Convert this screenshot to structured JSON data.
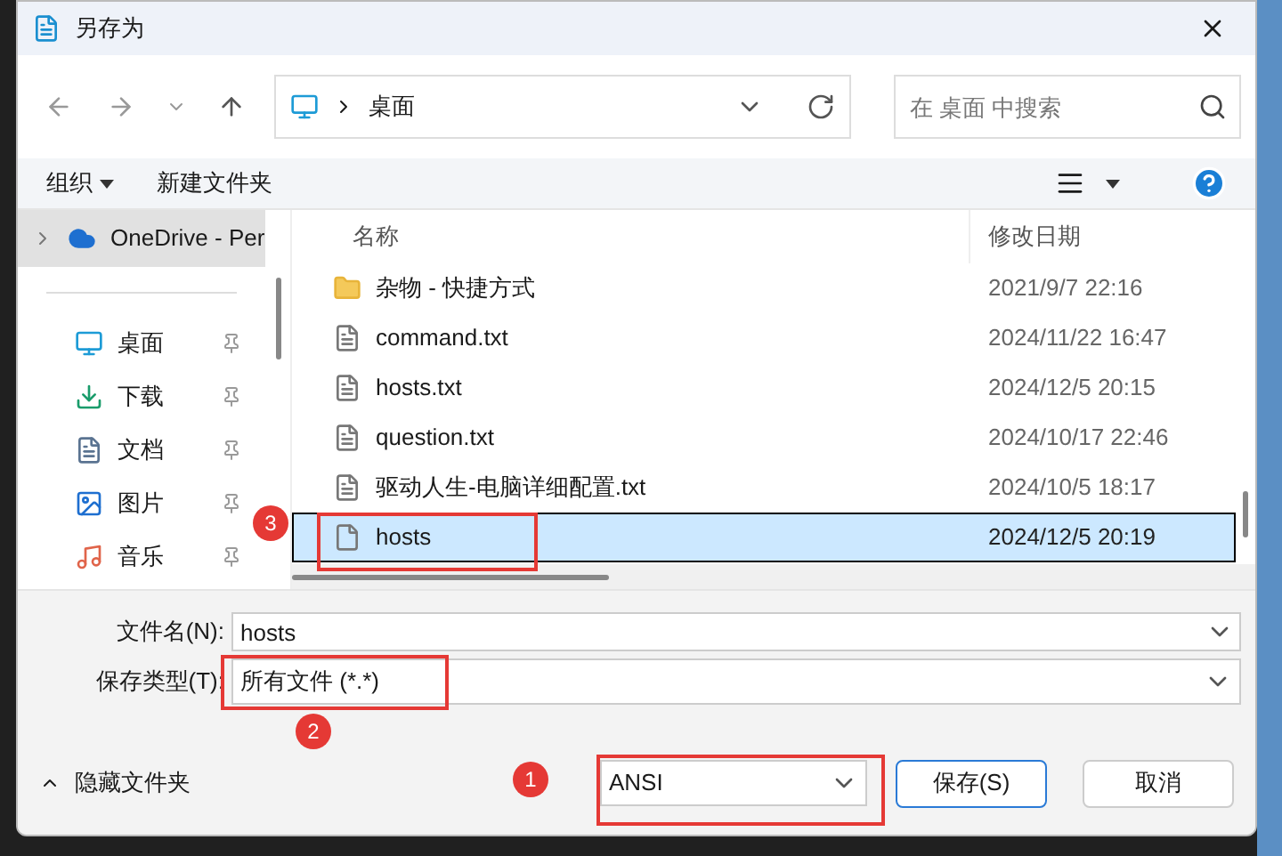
{
  "window": {
    "title": "另存为"
  },
  "address": {
    "path": "桌面"
  },
  "search": {
    "placeholder": "在 桌面 中搜索"
  },
  "toolbar": {
    "organize": "组织",
    "new_folder": "新建文件夹"
  },
  "sidebar": {
    "items": [
      {
        "label": "OneDrive - Per",
        "kind": "cloud",
        "selected": true
      },
      {
        "label": "桌面",
        "kind": "desktop",
        "selected": false
      },
      {
        "label": "下载",
        "kind": "download",
        "selected": false
      },
      {
        "label": "文档",
        "kind": "documents",
        "selected": false
      },
      {
        "label": "图片",
        "kind": "pictures",
        "selected": false
      },
      {
        "label": "音乐",
        "kind": "music",
        "selected": false
      }
    ]
  },
  "files": {
    "columns": [
      "名称",
      "修改日期"
    ],
    "rows": [
      {
        "name": "杂物 - 快捷方式",
        "modified": "2021/9/7 22:16",
        "kind": "shortcut",
        "selected": false
      },
      {
        "name": "command.txt",
        "modified": "2024/11/22 16:47",
        "kind": "text",
        "selected": false
      },
      {
        "name": "hosts.txt",
        "modified": "2024/12/5 20:15",
        "kind": "text",
        "selected": false
      },
      {
        "name": "question.txt",
        "modified": "2024/10/17 22:46",
        "kind": "text",
        "selected": false
      },
      {
        "name": "驱动人生-电脑详细配置.txt",
        "modified": "2024/10/5 18:17",
        "kind": "text",
        "selected": false
      },
      {
        "name": "hosts",
        "modified": "2024/12/5 20:19",
        "kind": "file",
        "selected": true
      }
    ]
  },
  "form": {
    "filename_label": "文件名(N):",
    "filename": "hosts",
    "type_label": "保存类型(T):",
    "type": "所有文件 (*.*)"
  },
  "footer": {
    "hide_folders": "隐藏文件夹",
    "encoding": "ANSI",
    "save": "保存(S)",
    "cancel": "取消"
  },
  "annotations": [
    {
      "number": "3",
      "kind": "file-row"
    },
    {
      "number": "2",
      "kind": "file-type"
    },
    {
      "number": "1",
      "kind": "encoding"
    }
  ]
}
